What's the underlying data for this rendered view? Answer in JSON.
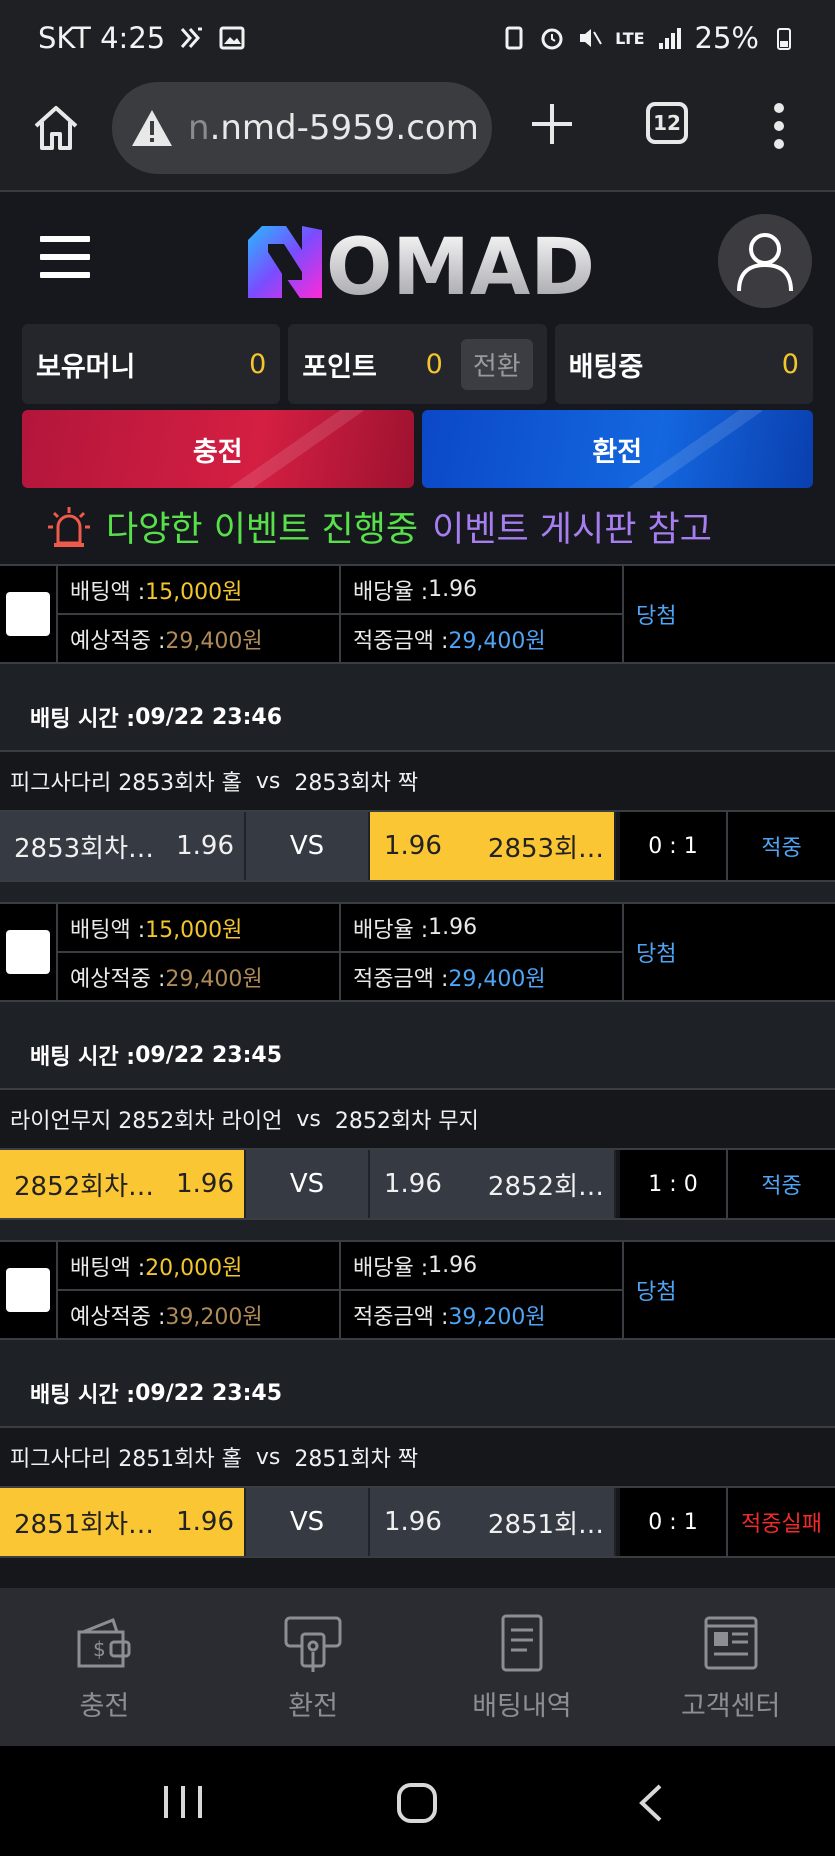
{
  "status_bar": {
    "carrier_time": "SKT 4:25",
    "battery": "25%",
    "network": "LTE"
  },
  "browser": {
    "url_faded": "n",
    "url_main": ".nmd-5959.com",
    "tab_count": "12"
  },
  "header": {
    "logo_text": "OMAD"
  },
  "balances": [
    {
      "label": "보유머니",
      "value": "0"
    },
    {
      "label": "포인트",
      "value": "0",
      "button": "전환"
    },
    {
      "label": "배팅중",
      "value": "0"
    }
  ],
  "actions": {
    "deposit": "충전",
    "withdraw": "환전"
  },
  "notice": {
    "part1": "다양한 이벤트 진행중",
    "part2": "이벤트 게시판 참고"
  },
  "labels": {
    "bet_amount": "배팅액 : ",
    "odds": "배당율 : ",
    "expected": "예상적중 : ",
    "win_amount": "적중금액 : ",
    "bet_time": "배팅 시간 : ",
    "vs_title": "vs",
    "vs": "VS"
  },
  "bet_groups": [
    {
      "info": {
        "amount": "15,000원",
        "odds": "1.96",
        "expected": "29,400원",
        "win": "29,400원",
        "status": "당첨"
      }
    },
    {
      "time": "09/22 23:46",
      "game": "피그사다리 2853회차 홀",
      "game_right": "2853회차 짝",
      "home": "2853회차…",
      "home_odds": "1.96",
      "away": "2853회…",
      "away_odds": "1.96",
      "score": "0 : 1",
      "result": "적중",
      "info": {
        "amount": "15,000원",
        "odds": "1.96",
        "expected": "29,400원",
        "win": "29,400원",
        "status": "당첨"
      }
    },
    {
      "time": "09/22 23:45",
      "game": "라이언무지 2852회차 라이언",
      "game_right": "2852회차 무지",
      "home": "2852회차…",
      "home_odds": "1.96",
      "away": "2852회…",
      "away_odds": "1.96",
      "score": "1 : 0",
      "result": "적중",
      "info": {
        "amount": "20,000원",
        "odds": "1.96",
        "expected": "39,200원",
        "win": "39,200원",
        "status": "당첨"
      }
    },
    {
      "time": "09/22 23:45",
      "game": "피그사다리 2851회차 홀",
      "game_right": "2851회차 짝",
      "home": "2851회차…",
      "home_odds": "1.96",
      "away": "2851회…",
      "away_odds": "1.96",
      "score": "0 : 1",
      "result": "적중실패"
    }
  ],
  "bottom_nav": [
    "충전",
    "환전",
    "배팅내역",
    "고객센터"
  ]
}
